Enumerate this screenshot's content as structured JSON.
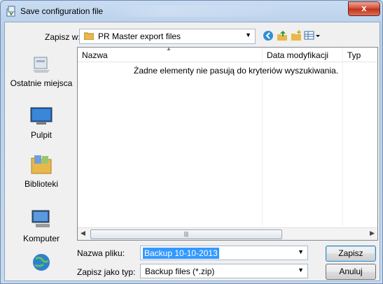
{
  "window": {
    "title": "Save configuration file",
    "close_glyph": "x"
  },
  "toolbar": {
    "save_in_label": "Zapisz w:",
    "folder_name": "PR Master export files",
    "icons": [
      "back-icon",
      "up-folder-icon",
      "new-folder-icon",
      "view-menu-icon"
    ]
  },
  "places": [
    {
      "name": "recent-places",
      "label": "Ostatnie miejsca"
    },
    {
      "name": "desktop",
      "label": "Pulpit"
    },
    {
      "name": "libraries",
      "label": "Biblioteki"
    },
    {
      "name": "computer",
      "label": "Komputer"
    },
    {
      "name": "network",
      "label": ""
    }
  ],
  "list": {
    "columns": [
      "Nazwa",
      "Data modyfikacji",
      "Typ"
    ],
    "empty_message": "Żadne elementy nie pasują do kryteriów wyszukiwania."
  },
  "form": {
    "filename_label": "Nazwa pliku:",
    "filename_value": "Backup 10-10-2013",
    "filetype_label": "Zapisz jako typ:",
    "filetype_value": "Backup files (*.zip)"
  },
  "buttons": {
    "save": "Zapisz",
    "cancel": "Anuluj"
  },
  "colors": {
    "accent": "#3399ff",
    "close": "#c7402a"
  }
}
